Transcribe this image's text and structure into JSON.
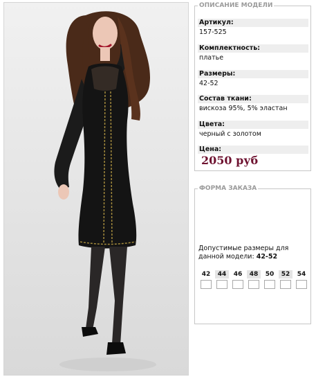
{
  "photo": {
    "alt": "",
    "colors": {
      "background": "#e4e4e4",
      "dress": "#141414",
      "trim": "#a38a3c",
      "hair": "#4a2a19",
      "skin": "#ecc7b6"
    }
  },
  "description": {
    "legend": "ОПИСАНИЕ МОДЕЛИ",
    "fields": [
      {
        "label": "Артикул:",
        "value": "157-525"
      },
      {
        "label": "Комплектность:",
        "value": "платье"
      },
      {
        "label": "Размеры:",
        "value": "42-52"
      },
      {
        "label": "Состав ткани:",
        "value": "вискоза 95%, 5% эластан"
      },
      {
        "label": "Цвета:",
        "value": "черный с золотом"
      }
    ],
    "price_label": "Цена:",
    "price_value": "2050 руб",
    "price_color": "#6e1230"
  },
  "order_form": {
    "legend": "ФОРМА ЗАКАЗА",
    "sizes_note": "Допустимые размеры для данной модели:",
    "sizes_range": "42-52",
    "sizes": [
      {
        "size": "42",
        "shaded": false,
        "checked": false
      },
      {
        "size": "44",
        "shaded": true,
        "checked": false
      },
      {
        "size": "46",
        "shaded": false,
        "checked": false
      },
      {
        "size": "48",
        "shaded": true,
        "checked": false
      },
      {
        "size": "50",
        "shaded": false,
        "checked": false
      },
      {
        "size": "52",
        "shaded": true,
        "checked": false
      },
      {
        "size": "54",
        "shaded": false,
        "checked": false
      }
    ]
  }
}
